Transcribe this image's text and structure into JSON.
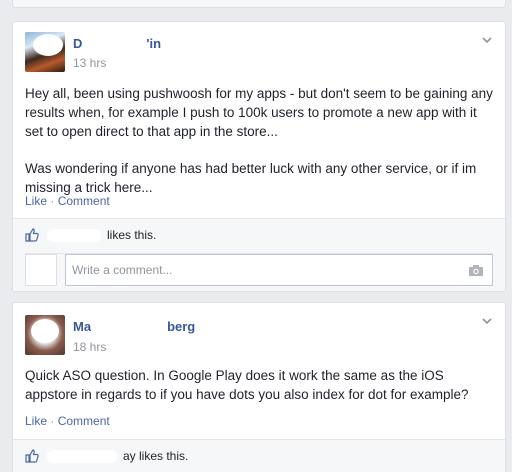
{
  "posts": [
    {
      "author_start": "D",
      "author_end": "'in",
      "time": "13 hrs",
      "paragraphs": [
        "Hey all, been using pushwoosh for my apps - but don't seem to be gaining any results when, for example I push to 100k users to promote a new app with it set to open direct to that app in the store...",
        "Was wondering if anyone has had better luck with any other service, or if im missing a trick here..."
      ],
      "like_label": "Like",
      "separator": "·",
      "comment_label": "Comment",
      "likes_suffix": "likes this.",
      "comment_placeholder": "Write a comment..."
    },
    {
      "author_start": "Ma",
      "author_end": "berg",
      "time": "18 hrs",
      "paragraphs": [
        "Quick ASO question. In Google Play does it work the same as the iOS appstore in regards to if you have dots you also index for dot for example?"
      ],
      "like_label": "Like",
      "separator": "·",
      "comment_label": "Comment",
      "likes_suffix": "ay likes this."
    }
  ],
  "icons": {
    "post_menu": "chevron-down-icon",
    "like": "thumbs-up-icon",
    "camera": "camera-icon"
  },
  "colors": {
    "link": "#4b67a1",
    "author": "#365899",
    "meta": "#90949c",
    "background": "#e9ebee"
  }
}
